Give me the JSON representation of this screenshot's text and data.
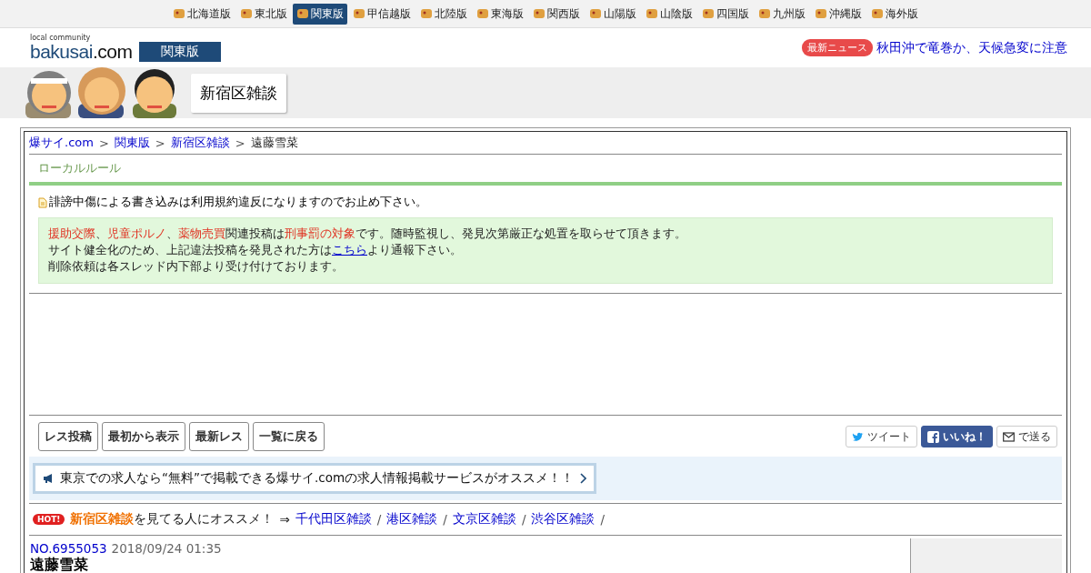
{
  "regions": [
    {
      "label": "北海道版",
      "selected": false
    },
    {
      "label": "東北版",
      "selected": false
    },
    {
      "label": "関東版",
      "selected": true
    },
    {
      "label": "甲信越版",
      "selected": false
    },
    {
      "label": "北陸版",
      "selected": false
    },
    {
      "label": "東海版",
      "selected": false
    },
    {
      "label": "関西版",
      "selected": false
    },
    {
      "label": "山陽版",
      "selected": false
    },
    {
      "label": "山陰版",
      "selected": false
    },
    {
      "label": "四国版",
      "selected": false
    },
    {
      "label": "九州版",
      "selected": false
    },
    {
      "label": "沖縄版",
      "selected": false
    },
    {
      "label": "海外版",
      "selected": false
    }
  ],
  "header": {
    "tagline": "local community",
    "logo_main": "bakusai",
    "logo_suffix": ".com",
    "edition": "関東版",
    "news_badge": "最新ニュース",
    "news_headline": "秋田沖で竜巻か、天候急変に注意"
  },
  "board_title": "新宿区雑談",
  "breadcrumb": [
    {
      "label": "爆サイ.com",
      "link": true
    },
    {
      "label": "関東版",
      "link": true
    },
    {
      "label": "新宿区雑談",
      "link": true
    },
    {
      "label": "遠藤雪菜",
      "link": false
    }
  ],
  "breadcrumb_separator": ">",
  "local_rule": {
    "heading": "ローカルルール",
    "notice": "誹謗中傷による書き込みは利用規約違反になりますのでお止め下さい。"
  },
  "warning_lines": [
    [
      {
        "kind": "warn",
        "text": "援助交際"
      },
      {
        "kind": "plain",
        "text": "、"
      },
      {
        "kind": "warn",
        "text": "児童ポルノ"
      },
      {
        "kind": "plain",
        "text": "、"
      },
      {
        "kind": "warn",
        "text": "薬物売買"
      },
      {
        "kind": "plain",
        "text": "関連投稿は"
      },
      {
        "kind": "warn",
        "text": "刑事罰の対象"
      },
      {
        "kind": "plain",
        "text": "です。随時監視し、発見次第厳正な処置を取らせて頂きます。"
      }
    ],
    [
      {
        "kind": "plain",
        "text": "サイト健全化のため、上記違法投稿を発見された方は"
      },
      {
        "kind": "link",
        "text": "こちら"
      },
      {
        "kind": "plain",
        "text": "より通報下さい。"
      }
    ],
    [
      {
        "kind": "plain",
        "text": "削除依頼は各スレッド内下部より受け付けております。"
      }
    ]
  ],
  "actions": [
    "レス投稿",
    "最初から表示",
    "最新レス",
    "一覧に戻る"
  ],
  "share": [
    {
      "kind": "twitter",
      "label": "ツイート"
    },
    {
      "kind": "facebook",
      "label": "いいね！"
    },
    {
      "kind": "mail",
      "label": "で送る"
    }
  ],
  "promo": "東京での求人なら“無料”で掲載できる爆サイ.comの求人情報掲載サービスがオススメ！！",
  "recommend": {
    "badge": "HOT!",
    "board": "新宿区雑談",
    "text": "を見てる人にオススメ！",
    "arrow": "⇒",
    "links": [
      "千代田区雑談",
      "港区雑談",
      "文京区雑談",
      "渋谷区雑談"
    ],
    "separator": "/"
  },
  "post": {
    "number": "NO.6955053",
    "date": "2018/09/24 01:35",
    "title": "遠藤雪菜"
  }
}
